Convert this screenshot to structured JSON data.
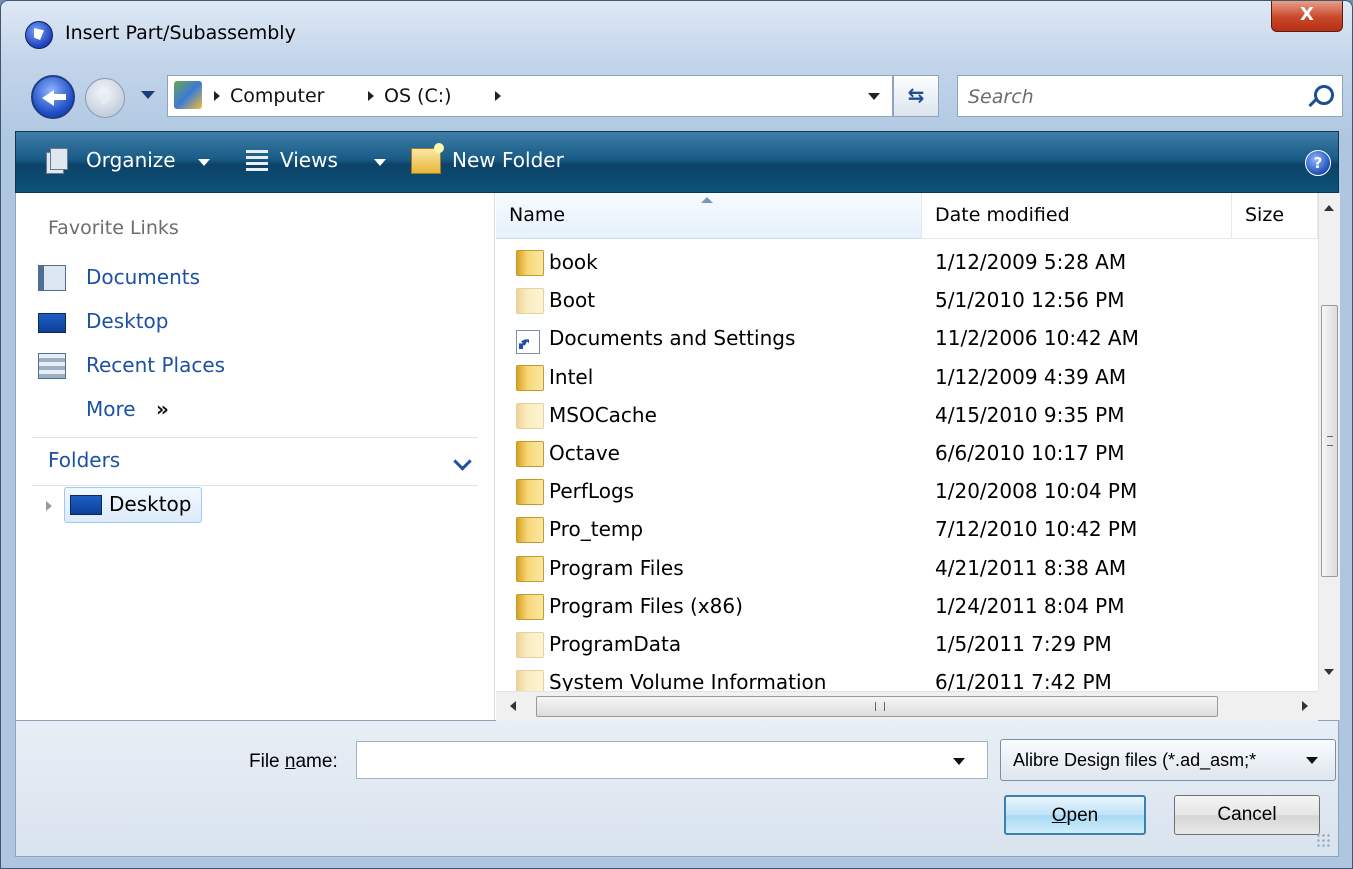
{
  "window": {
    "title": "Insert Part/Subassembly",
    "close_label": "X"
  },
  "address": {
    "crumbs": [
      "Computer",
      "OS (C:)"
    ],
    "search_placeholder": "Search"
  },
  "toolbar": {
    "organize": "Organize",
    "views": "Views",
    "new_folder": "New Folder",
    "help": "?"
  },
  "nav": {
    "favorites_heading": "Favorite Links",
    "favorites": [
      {
        "label": "Documents",
        "icon": "documents-icon"
      },
      {
        "label": "Desktop",
        "icon": "desktop-icon"
      },
      {
        "label": "Recent Places",
        "icon": "recent-places-icon"
      }
    ],
    "more": "More",
    "more_glyph": "»",
    "folders_heading": "Folders",
    "tree_item": "Desktop"
  },
  "list": {
    "columns": {
      "name": "Name",
      "date": "Date modified",
      "size": "Size"
    },
    "rows": [
      {
        "name": "book",
        "date": "1/12/2009 5:28 AM",
        "icon": "folder",
        "faded": false
      },
      {
        "name": "Boot",
        "date": "5/1/2010 12:56 PM",
        "icon": "folder",
        "faded": true
      },
      {
        "name": "Documents and Settings",
        "date": "11/2/2006 10:42 AM",
        "icon": "shortcut",
        "faded": false
      },
      {
        "name": "Intel",
        "date": "1/12/2009 4:39 AM",
        "icon": "folder",
        "faded": false
      },
      {
        "name": "MSOCache",
        "date": "4/15/2010 9:35 PM",
        "icon": "folder",
        "faded": true
      },
      {
        "name": "Octave",
        "date": "6/6/2010 10:17 PM",
        "icon": "folder",
        "faded": false
      },
      {
        "name": "PerfLogs",
        "date": "1/20/2008 10:04 PM",
        "icon": "folder",
        "faded": false
      },
      {
        "name": "Pro_temp",
        "date": "7/12/2010 10:42 PM",
        "icon": "folder",
        "faded": false
      },
      {
        "name": "Program Files",
        "date": "4/21/2011 8:38 AM",
        "icon": "folder",
        "faded": false
      },
      {
        "name": "Program Files (x86)",
        "date": "1/24/2011 8:04 PM",
        "icon": "folder",
        "faded": false
      },
      {
        "name": "ProgramData",
        "date": "1/5/2011 7:29 PM",
        "icon": "folder",
        "faded": true
      },
      {
        "name": "System Volume Information",
        "date": "6/1/2011 7:42 PM",
        "icon": "folder",
        "faded": true
      }
    ]
  },
  "footer": {
    "file_name_label_pre": "File ",
    "file_name_label_ul": "n",
    "file_name_label_post": "ame:",
    "file_name_value": "",
    "filter": "Alibre Design files (*.ad_asm;*",
    "open_ul": "O",
    "open_rest": "pen",
    "cancel": "Cancel"
  }
}
